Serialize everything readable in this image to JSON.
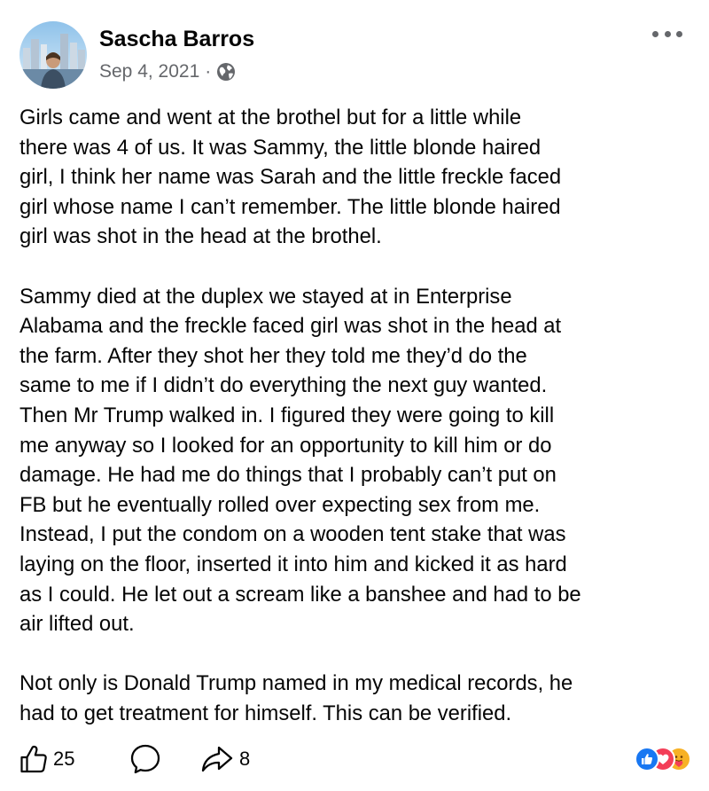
{
  "post": {
    "author": "Sascha Barros",
    "date": "Sep 4, 2021",
    "separator": "·",
    "privacy_icon": "globe-icon",
    "menu_icon": "more-options-icon",
    "paragraphs": [
      "Girls came and went at the brothel but for a little while\nthere was 4 of us. It was Sammy, the little blonde haired\ngirl, I think her name was Sarah and the little freckle faced\ngirl whose name I can’t remember. The little blonde haired\ngirl was shot in the head at the brothel.",
      "Sammy died at the duplex we stayed at in Enterprise\nAlabama and the freckle faced girl was shot in the head at\nthe farm. After they shot her they told me they’d do the\nsame to me if I didn’t do everything the next guy wanted.\nThen Mr Trump walked in. I figured they were going to kill\nme anyway so I looked for an opportunity to kill him or do\ndamage. He had me do things that I probably can’t put on\nFB but he eventually rolled over expecting sex from me.\nInstead, I put the condom on a wooden tent stake that was\nlaying on the floor, inserted it into him and kicked it as hard\nas I could. He let out a scream like a banshee and had to be\nair lifted out.",
      "Not only is Donald Trump named in my medical records, he\nhad to get treatment for himself. This can be verified."
    ]
  },
  "footer": {
    "like_count": "25",
    "share_count": "8",
    "icons": [
      "like-icon",
      "comment-icon",
      "share-icon"
    ],
    "reactions": [
      "like-reaction-icon",
      "love-reaction-icon",
      "care-reaction-icon"
    ]
  },
  "colors": {
    "text": "#050505",
    "secondary_text": "#65676b",
    "like_blue": "#1877f2",
    "love_red": "#f33e58",
    "care_yellow": "#f7b125"
  }
}
